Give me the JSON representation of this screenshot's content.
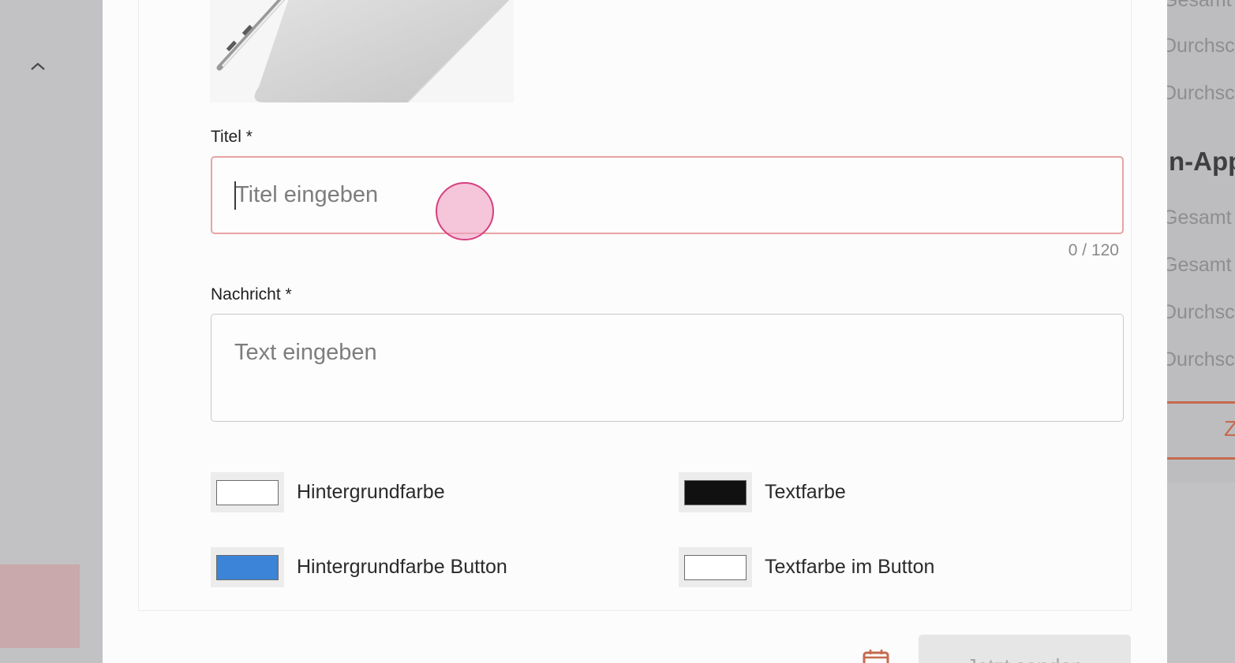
{
  "background": {
    "right_texts": [
      "Gesamt",
      "Durchsc",
      "Durchsc",
      "Gesamt",
      "Gesamt",
      "Durchsc",
      "Durchsc"
    ],
    "right_heading": "n-App",
    "right_button_label": "Z"
  },
  "form": {
    "title_label": "Titel *",
    "title_placeholder": "Titel eingeben",
    "title_value": "",
    "title_counter": "0 / 120",
    "message_label": "Nachricht *",
    "message_placeholder": "Text eingeben",
    "message_value": ""
  },
  "colors": {
    "background": {
      "label": "Hintergrundfarbe",
      "value": "#ffffff"
    },
    "text": {
      "label": "Textfarbe",
      "value": "#111111"
    },
    "button_background": {
      "label": "Hintergrundfarbe Button",
      "value": "#3b84d8"
    },
    "button_text": {
      "label": "Textfarbe im Button",
      "value": "#ffffff"
    }
  },
  "actions": {
    "send_label": "Jetzt senden"
  },
  "accent_colors": {
    "error_border": "#e8a3a3",
    "orange_accent": "#c56a4f"
  }
}
